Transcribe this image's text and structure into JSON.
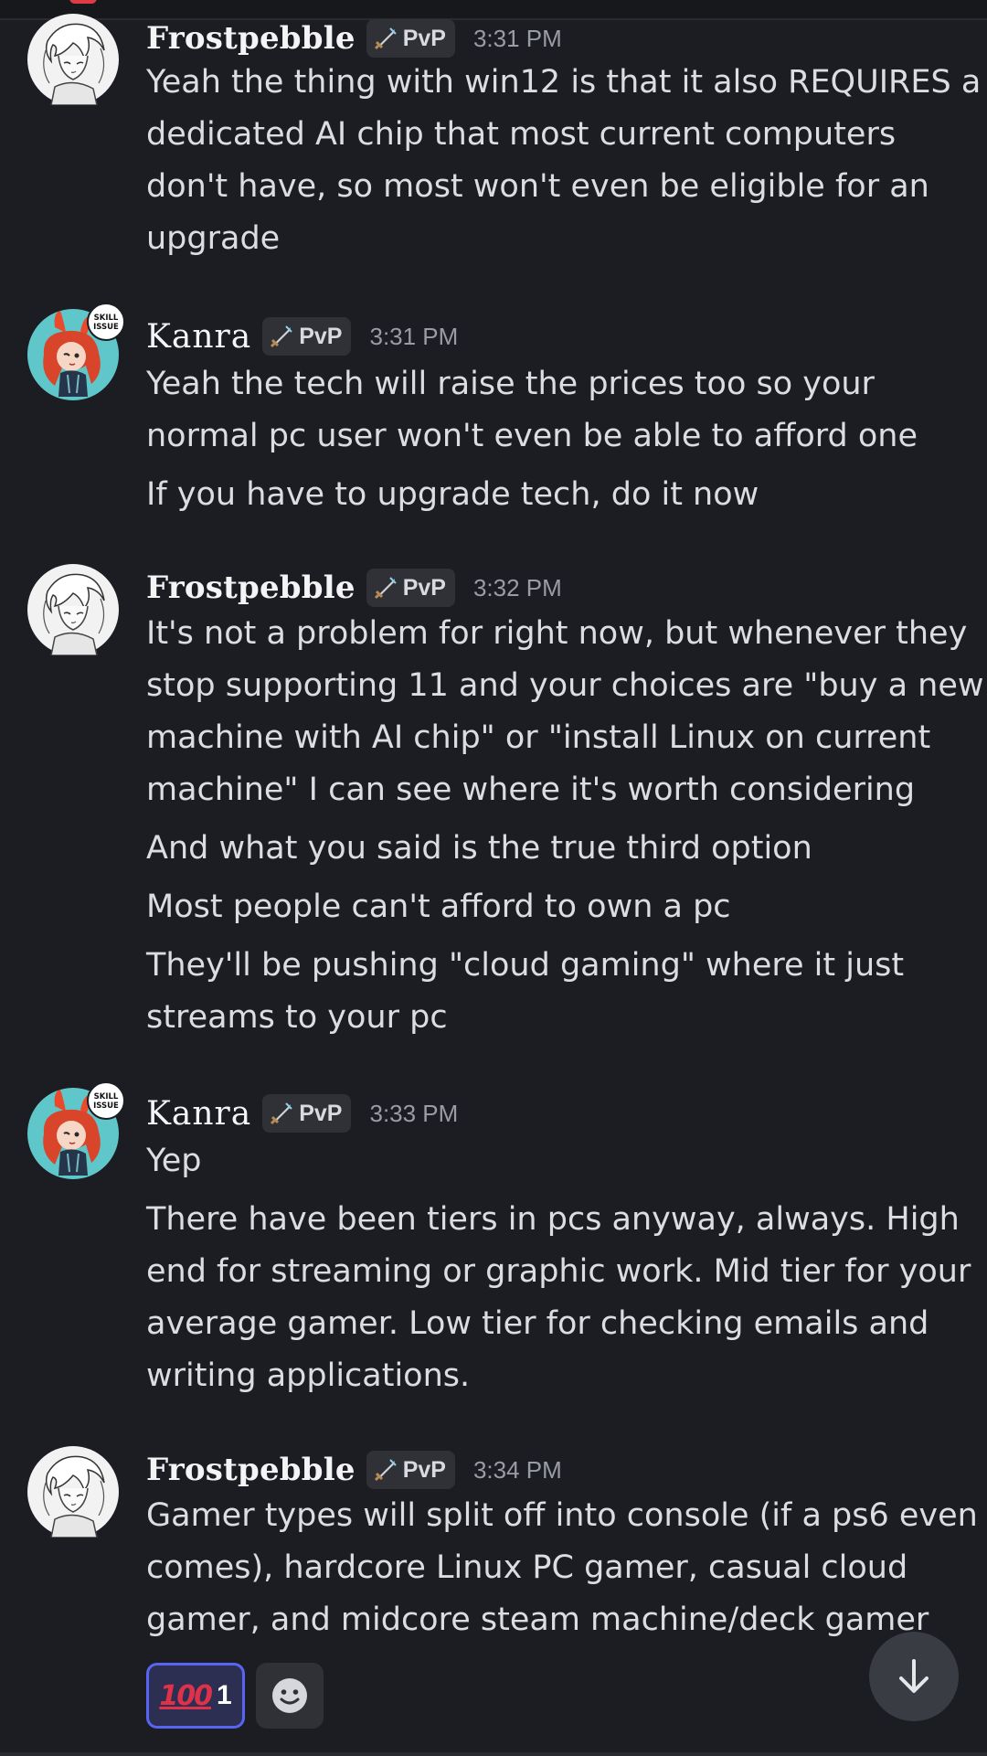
{
  "colors": {
    "background": "#1c1d22",
    "text": "#dcdde1",
    "timestamp": "#9a9ca5",
    "tag_bg": "#2f3137",
    "reaction_active_border": "#5865f2",
    "reaction_emoji": "#e0314a"
  },
  "messages": [
    {
      "author": "Frostpebble",
      "tag": "PvP",
      "time": "3:31 PM",
      "lines": [
        "Yeah the thing with win12 is that it also REQUIRES a",
        "dedicated AI chip that most current computers",
        "don't have, so most won't even be eligible for an",
        "upgrade"
      ]
    },
    {
      "author": "Kanra",
      "tag": "PvP",
      "time": "3:31 PM",
      "avatar_badge": "SKILL ISSUE",
      "lines": [
        "Yeah the tech will raise the prices too so your",
        "normal pc user won't even be able to afford one",
        "If you have to upgrade tech, do it now"
      ]
    },
    {
      "author": "Frostpebble",
      "tag": "PvP",
      "time": "3:32 PM",
      "lines": [
        "It's not a problem for right now, but whenever they",
        "stop supporting 11 and your choices are \"buy a new",
        "machine with AI chip\" or \"install Linux on current",
        "machine\" I can see where it's worth considering",
        "And what you said is the true third option",
        "Most people can't afford to own a pc",
        "They'll be pushing \"cloud gaming\" where it just",
        "streams to your pc"
      ]
    },
    {
      "author": "Kanra",
      "tag": "PvP",
      "time": "3:33 PM",
      "avatar_badge": "SKILL ISSUE",
      "lines": [
        "Yep",
        "There have been tiers in pcs anyway, always. High",
        "end for streaming or graphic work. Mid tier for your",
        "average gamer. Low tier for checking emails and",
        "writing applications."
      ]
    },
    {
      "author": "Frostpebble",
      "tag": "PvP",
      "time": "3:34 PM",
      "lines": [
        "Gamer types will split off into console (if a ps6 even",
        "comes), hardcore Linux PC gamer, casual cloud",
        "gamer, and midcore steam machine/deck gamer"
      ]
    }
  ],
  "reactions": [
    {
      "emoji": "100",
      "count": "1",
      "icon": "hundred-points-emoji",
      "active": true
    },
    {
      "icon": "add-reaction-smiley-icon"
    }
  ],
  "scroll_button": {
    "icon": "arrow-down-icon"
  }
}
